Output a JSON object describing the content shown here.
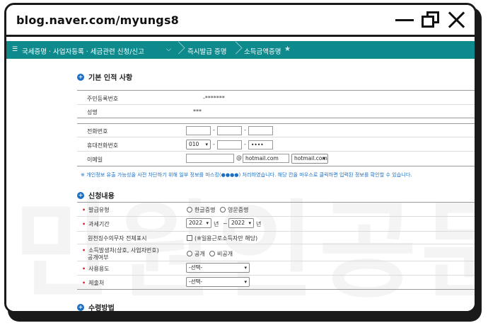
{
  "window": {
    "url": "blog.naver.com/myungs8"
  },
  "nav": {
    "menu_icon": "hamburger-icon",
    "category": "국세증명 · 사업자등록 · 세금관련 신청/신고",
    "crumb1": "즉시발급 증명",
    "crumb2": "소득금액증명",
    "star_icon": "star-icon",
    "theme_color": "#0e8a8d"
  },
  "basic": {
    "title": "기본 인적 사항",
    "rrn_label": "주민등록번호",
    "rrn_value": "-*******",
    "name_label": "성명",
    "name_value": "***",
    "phone_label": "전화번호",
    "phone_sep": "-",
    "mobile_label": "휴대전화번호",
    "mobile_prefix": "010",
    "mobile_last": "••••",
    "email_label": "이메일",
    "email_at": "@",
    "email_domain": "hotmail.com",
    "email_select": "hotmail.com",
    "notice": "※ 개인정보 유출 가능성을 사전 차단하기 위해 일부 정보를 마스킹(●●●●) 처리하였습니다. 해당 칸을 마우스로 클릭하면 입력된 정보를 확인할 수 있습니다."
  },
  "apply": {
    "title": "신청내용",
    "type_label": "발급유형",
    "type_opt1": "한글증명",
    "type_opt2": "영문증명",
    "period_label": "과세기간",
    "year_from": "2022",
    "year_unit1": "년",
    "tilde": "~",
    "year_to": "2022",
    "year_unit2": "년",
    "withholding_label": "원천징수의무자 전체표시",
    "withholding_note": "(※일용근로소득자만 해당)",
    "disclose_label_1": "소득발생처(상호, 사업자번호)",
    "disclose_label_2": "공개여부",
    "disclose_opt1": "공개",
    "disclose_opt2": "비공개",
    "usage_label": "사용용도",
    "usage_value": "-선택-",
    "submit_label": "제출처",
    "submit_value": "-선택-"
  },
  "receive": {
    "title": "수령방법"
  },
  "watermark": "민원인공문"
}
